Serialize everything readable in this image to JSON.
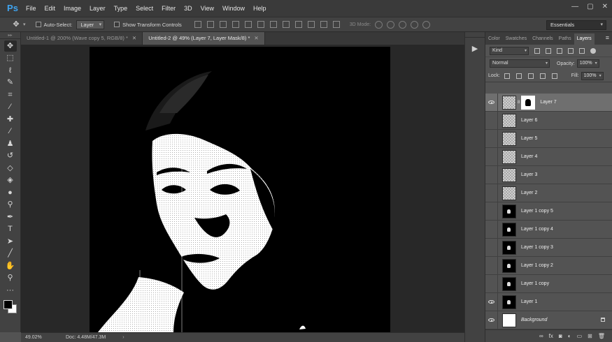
{
  "app": {
    "logo": "Ps"
  },
  "menu": [
    "File",
    "Edit",
    "Image",
    "Layer",
    "Type",
    "Select",
    "Filter",
    "3D",
    "View",
    "Window",
    "Help"
  ],
  "window_controls": {
    "minimize": "—",
    "restore": "▢",
    "close": "✕"
  },
  "options_bar": {
    "auto_select_label": "Auto-Select:",
    "auto_select_value": "Layer",
    "show_transform_label": "Show Transform Controls",
    "mode_3d_label": "3D Mode:",
    "workspace": "Essentials"
  },
  "tabs": [
    {
      "label": "Untitled-1 @ 200% (Wave copy 5, RGB/8) *",
      "active": false
    },
    {
      "label": "Untitled-2 @ 49% (Layer 7, Layer Mask/8) *",
      "active": true
    }
  ],
  "status": {
    "zoom": "49.02%",
    "doc": "Doc: 4.48M/47.3M"
  },
  "panel": {
    "tabs": [
      "Color",
      "Swatches",
      "Channels",
      "Paths",
      "Layers"
    ],
    "active_tab": "Layers",
    "kind_label": "Kind",
    "blend_mode": "Normal",
    "opacity_label": "Opacity:",
    "opacity_value": "100%",
    "lock_label": "Lock:",
    "fill_label": "Fill:",
    "fill_value": "100%"
  },
  "layers": [
    {
      "name": "Layer 7",
      "thumb": "checker",
      "mask": true,
      "visible": true,
      "selected": true
    },
    {
      "name": "Layer 6",
      "thumb": "checker",
      "visible": false
    },
    {
      "name": "Layer 5",
      "thumb": "checker",
      "visible": false
    },
    {
      "name": "Layer 4",
      "thumb": "checker",
      "visible": false
    },
    {
      "name": "Layer 3",
      "thumb": "checker",
      "visible": false
    },
    {
      "name": "Layer 2",
      "thumb": "checker",
      "visible": false
    },
    {
      "name": "Layer 1 copy 5",
      "thumb": "black",
      "visible": false
    },
    {
      "name": "Layer 1 copy 4",
      "thumb": "black",
      "visible": false
    },
    {
      "name": "Layer 1 copy 3",
      "thumb": "black",
      "visible": false
    },
    {
      "name": "Layer 1 copy 2",
      "thumb": "black",
      "visible": false
    },
    {
      "name": "Layer 1 copy",
      "thumb": "black",
      "visible": false
    },
    {
      "name": "Layer 1",
      "thumb": "black",
      "visible": true
    },
    {
      "name": "Background",
      "thumb": "white",
      "visible": true,
      "locked": true,
      "italic": true
    }
  ],
  "tools": [
    "move-tool-icon",
    "marquee-tool-icon",
    "lasso-tool-icon",
    "quick-select-tool-icon",
    "crop-tool-icon",
    "eyedropper-tool-icon",
    "healing-brush-icon",
    "brush-tool-icon",
    "clone-stamp-icon",
    "history-brush-icon",
    "eraser-tool-icon",
    "paint-bucket-icon",
    "blur-tool-icon",
    "dodge-tool-icon",
    "pen-tool-icon",
    "type-tool-icon",
    "path-select-icon",
    "rectangle-tool-icon",
    "hand-tool-icon",
    "zoom-tool-icon",
    "more-tools-icon"
  ],
  "colors": {
    "accent": "#3fa4f0",
    "menubar": "#3a3a3a",
    "panel": "#535353",
    "canvas": "#282828"
  }
}
